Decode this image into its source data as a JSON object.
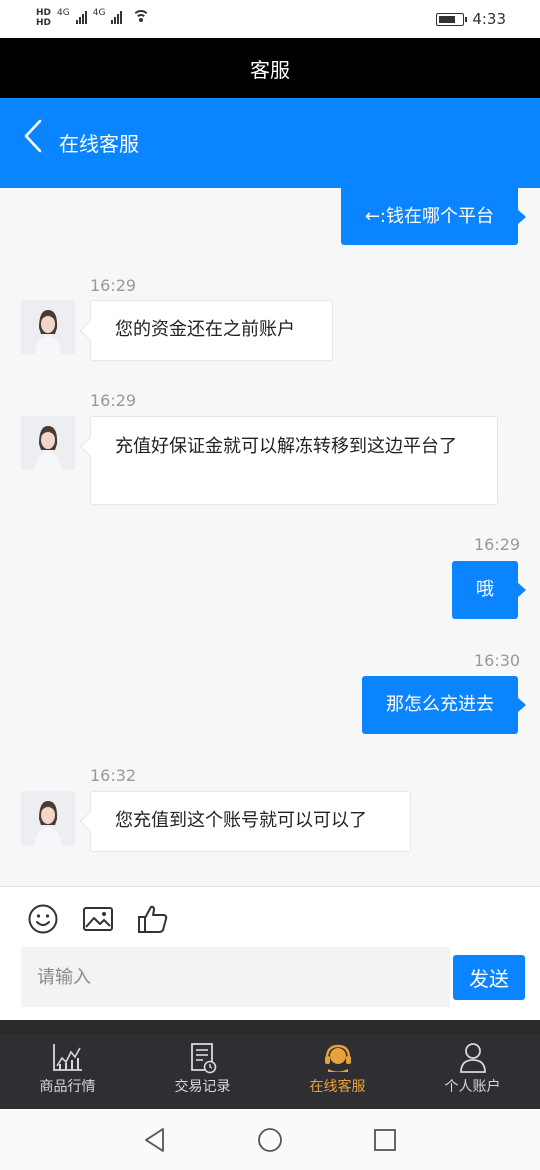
{
  "status_bar": {
    "hd_top": "HD",
    "hd_bottom": "HD",
    "net1": "4G",
    "net2": "4G",
    "time": "4:33"
  },
  "title_bar": {
    "title": "客服"
  },
  "header": {
    "title": "在线客服",
    "back_icon": "chevron-left-icon"
  },
  "messages": [
    {
      "side": "right",
      "time": "",
      "text": "←:钱在哪个平台"
    },
    {
      "side": "left",
      "time": "16:29",
      "text": "您的资金还在之前账户"
    },
    {
      "side": "left",
      "time": "16:29",
      "text": "充值好保证金就可以解冻转移到这边平台了"
    },
    {
      "side": "right",
      "time": "16:29",
      "text": "哦"
    },
    {
      "side": "right",
      "time": "16:30",
      "text": "那怎么充进去"
    },
    {
      "side": "left",
      "time": "16:32",
      "text": "您充值到这个账号就可以可以了"
    }
  ],
  "composer": {
    "tools": [
      "emoji-icon",
      "image-icon",
      "thumbs-up-icon"
    ],
    "placeholder": "请输入",
    "send_label": "发送"
  },
  "tabs": [
    {
      "label": "商品行情",
      "icon": "chart-icon",
      "active": false
    },
    {
      "label": "交易记录",
      "icon": "record-icon",
      "active": false
    },
    {
      "label": "在线客服",
      "icon": "headset-icon",
      "active": true
    },
    {
      "label": "个人账户",
      "icon": "user-icon",
      "active": false
    }
  ],
  "colors": {
    "accent": "#0a84ff",
    "active_tab": "#e8a23b",
    "tabbar": "#2f2f33"
  }
}
